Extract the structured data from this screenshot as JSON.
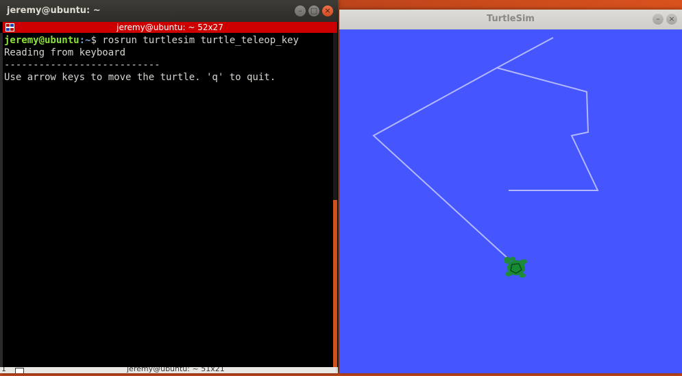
{
  "terminal": {
    "window_title": "jeremy@ubuntu: ~",
    "tmux_status": "jeremy@ubuntu: ~ 52x27",
    "lines": [
      {
        "user": "jeremy@ubuntu",
        "path": ":~",
        "prompt_end": "$ ",
        "command": "rosrun turtlesim turtle_teleop_key"
      },
      {
        "text": "Reading from keyboard"
      },
      {
        "text": "---------------------------"
      },
      {
        "text": "Use arrow keys to move the turtle. 'q' to quit."
      }
    ],
    "bottom_strip_label": "jeremy@ubuntu: ~ 51x21",
    "bottom_left_label": "1"
  },
  "window_controls": {
    "minimize": "–",
    "maximize": "□",
    "close": "×"
  },
  "turtlesim": {
    "window_title": "TurtleSim",
    "background_color": "#4556ff",
    "pen_color": "#b3b8ff",
    "turtle_color": "#1f8a3a",
    "turtle_heading_deg": 135
  },
  "colors": {
    "tmux_bar": "#cc0000",
    "prompt_user": "#8ae234",
    "prompt_path": "#729fcf",
    "terminal_text": "#d3d7cf"
  }
}
